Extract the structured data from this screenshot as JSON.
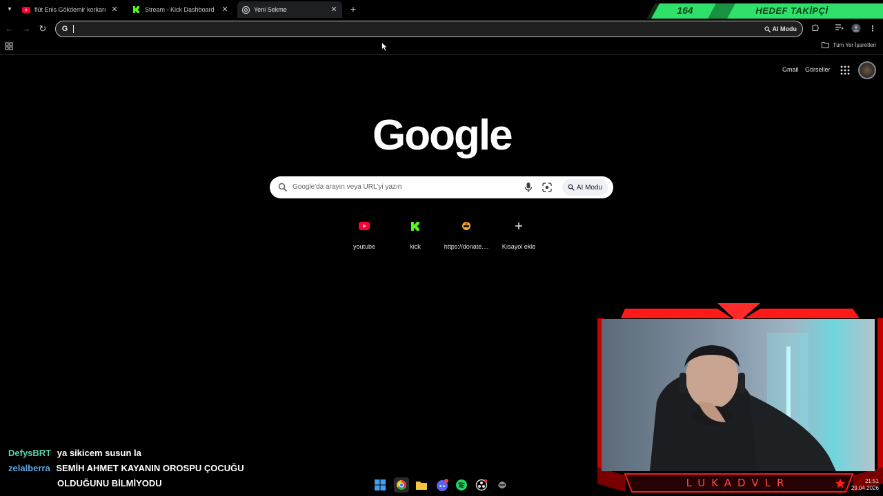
{
  "tabs": [
    {
      "title": "flüt Enis Gökdemir korkarım gi",
      "favicon": "youtube-icon",
      "active": false
    },
    {
      "title": "Stream - Kick Dashboard",
      "favicon": "kick-icon",
      "active": false
    },
    {
      "title": "Yeni Sekme",
      "favicon": "chrome-icon",
      "active": true
    }
  ],
  "goal_overlay": {
    "count": "164",
    "label": "HEDEF TAKİPÇİ"
  },
  "omnibox": {
    "value": "",
    "ai_mode_label": "AI Modu"
  },
  "bookmarks": {
    "all_bookmarks_label": "Tüm Yer İşaretleri"
  },
  "ntp": {
    "header_links": {
      "gmail": "Gmail",
      "images": "Görseller"
    },
    "logo_text": "Google",
    "search": {
      "placeholder": "Google'da arayın veya URL'yi yazın",
      "ai_mode_label": "AI Modu"
    },
    "shortcuts": [
      {
        "label": "youtube",
        "icon": "youtube-icon"
      },
      {
        "label": "kick",
        "icon": "kick-icon"
      },
      {
        "label": "https://donate....",
        "icon": "donate-icon"
      },
      {
        "label": "Kısayol ekle",
        "icon": "plus-icon"
      }
    ]
  },
  "stream_overlay": {
    "streamer_name": "LUKADVLR",
    "chat": [
      {
        "user": "DefysBRT",
        "message": "ya sikicem susun la"
      },
      {
        "user": "zelalberra",
        "message": "SEMİH AHMET KAYANIN OROSPU ÇOCUĞU",
        "message_cont": "OLDUĞUNU BİLMİYODU"
      }
    ]
  },
  "taskbar": {
    "time": "21:51",
    "date": "29.04.2026"
  },
  "colors": {
    "accent_red": "#ff1a1a",
    "goal_green": "#2fe06a",
    "youtube_red": "#ff0033",
    "kick_green": "#53fc18"
  }
}
